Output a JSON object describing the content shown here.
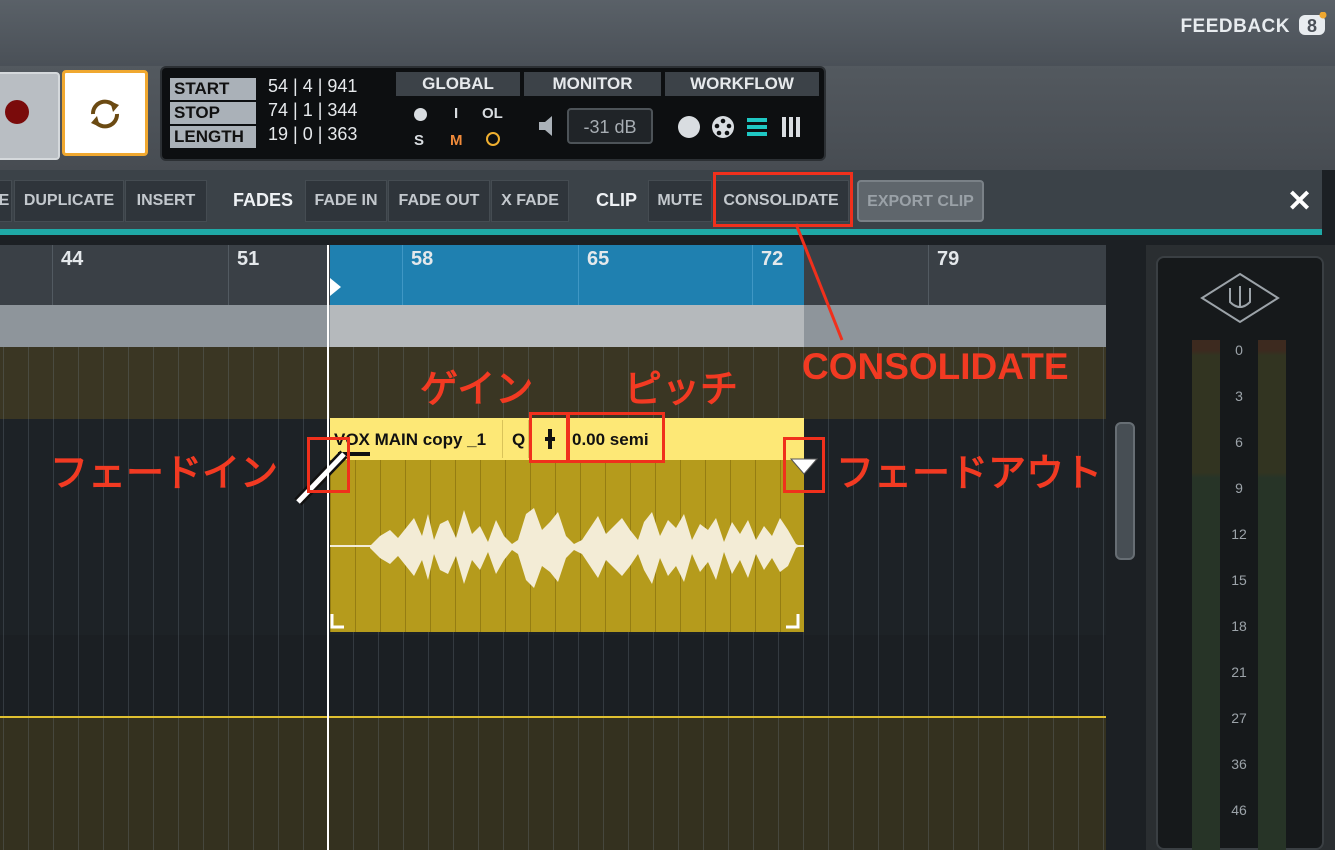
{
  "header": {
    "feedback_label": "FEEDBACK",
    "feedback_logo_glyph": "8"
  },
  "transport": {
    "position": {
      "start_label": "START",
      "start_value": "54 | 4 | 941",
      "stop_label": "STOP",
      "stop_value": "74 | 1 | 344",
      "length_label": "LENGTH",
      "length_value": "19 | 0 | 363"
    },
    "global": {
      "title": "GLOBAL",
      "i_label": "I",
      "ol_label": "OL",
      "s_label": "S",
      "m_label": "M"
    },
    "monitor": {
      "title": "MONITOR",
      "level": "-31 dB"
    },
    "workflow": {
      "title": "WORKFLOW"
    }
  },
  "toolbar": {
    "partial_label": "E",
    "duplicate": "DUPLICATE",
    "insert": "INSERT",
    "fades_label": "FADES",
    "fade_in": "FADE IN",
    "fade_out": "FADE OUT",
    "x_fade": "X FADE",
    "clip_label": "CLIP",
    "mute": "MUTE",
    "consolidate": "CONSOLIDATE",
    "export_clip": "EXPORT CLIP",
    "close": "✕"
  },
  "ruler": {
    "marks": [
      "44",
      "51",
      "58",
      "65",
      "72",
      "79"
    ]
  },
  "clip": {
    "name": "VOX MAIN copy _1",
    "quantize": "Q",
    "pitch": "0.00 semi"
  },
  "annotations": {
    "gain": "ゲイン",
    "pitch": "ピッチ",
    "fade_in": "フェードイン",
    "fade_out": "フェードアウト",
    "consolidate": "CONSOLIDATE"
  },
  "meter": {
    "scale": [
      "0",
      "3",
      "6",
      "9",
      "12",
      "15",
      "18",
      "21",
      "27",
      "36",
      "46"
    ]
  },
  "colors": {
    "accent_teal": "#1fa9a6",
    "annotation_red": "#f0301c",
    "clip_yellow": "#fde876",
    "loop_blue": "#1f80b0"
  }
}
